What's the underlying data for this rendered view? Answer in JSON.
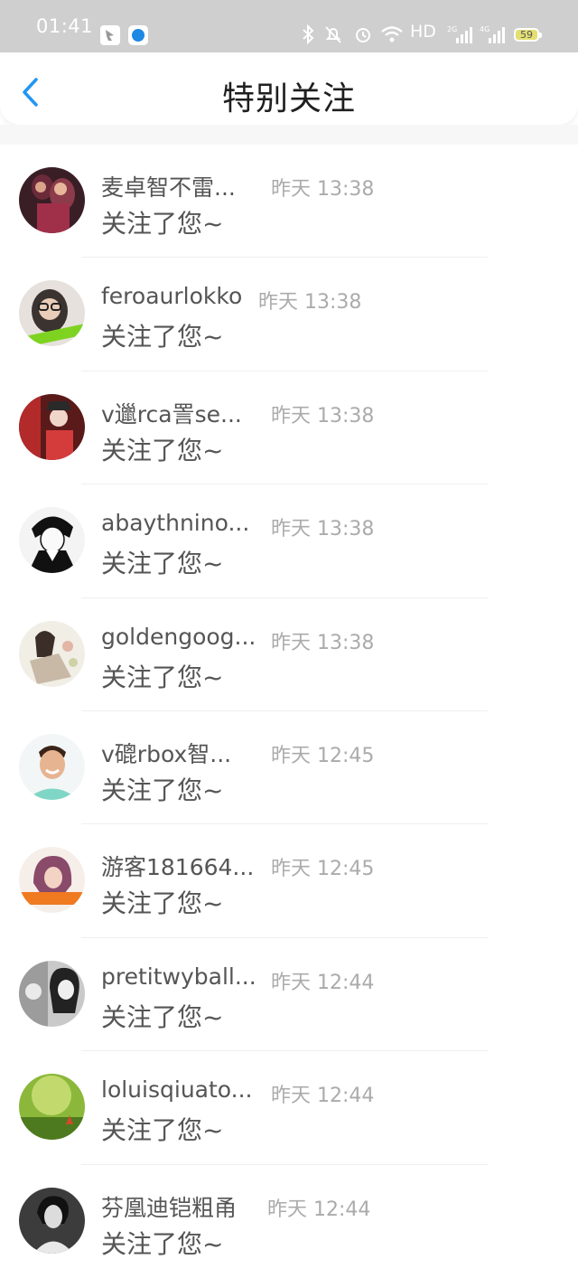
{
  "status_bar": {
    "time": "01:41",
    "network_label": "HD",
    "battery": "59",
    "icons": [
      "app-icon-1",
      "app-icon-2",
      "bluetooth-icon",
      "mute-icon",
      "alarm-icon",
      "wifi-icon",
      "hd-icon",
      "signal-2g-icon",
      "signal-4g-icon",
      "battery-icon"
    ]
  },
  "header": {
    "back_icon": "chevron-left-icon",
    "title": "特别关注"
  },
  "list": {
    "items": [
      {
        "name": "麦卓智不雷...",
        "time": "昨天 13:38",
        "action": "关注了您~"
      },
      {
        "name": "feroaurlokko",
        "time": "昨天 13:38",
        "action": "关注了您~"
      },
      {
        "name": "v邋rca詈se...",
        "time": "昨天 13:38",
        "action": "关注了您~"
      },
      {
        "name": "abaythnino...",
        "time": "昨天 13:38",
        "action": "关注了您~"
      },
      {
        "name": "goldengoog...",
        "time": "昨天 13:38",
        "action": "关注了您~"
      },
      {
        "name": "v磇rbox智...",
        "time": "昨天 12:45",
        "action": "关注了您~"
      },
      {
        "name": "游客181664...",
        "time": "昨天 12:45",
        "action": "关注了您~"
      },
      {
        "name": "pretitwyball...",
        "time": "昨天 12:44",
        "action": "关注了您~"
      },
      {
        "name": "loluisqiuato...",
        "time": "昨天 12:44",
        "action": "关注了您~"
      },
      {
        "name": "芬凰迪铠粗甬",
        "time": "昨天 12:44",
        "action": "关注了您~"
      }
    ]
  },
  "colors": {
    "accent": "#2196f3",
    "status_bar_bg": "#cfcfcf",
    "text_primary": "#555555",
    "text_secondary": "#ababab"
  }
}
